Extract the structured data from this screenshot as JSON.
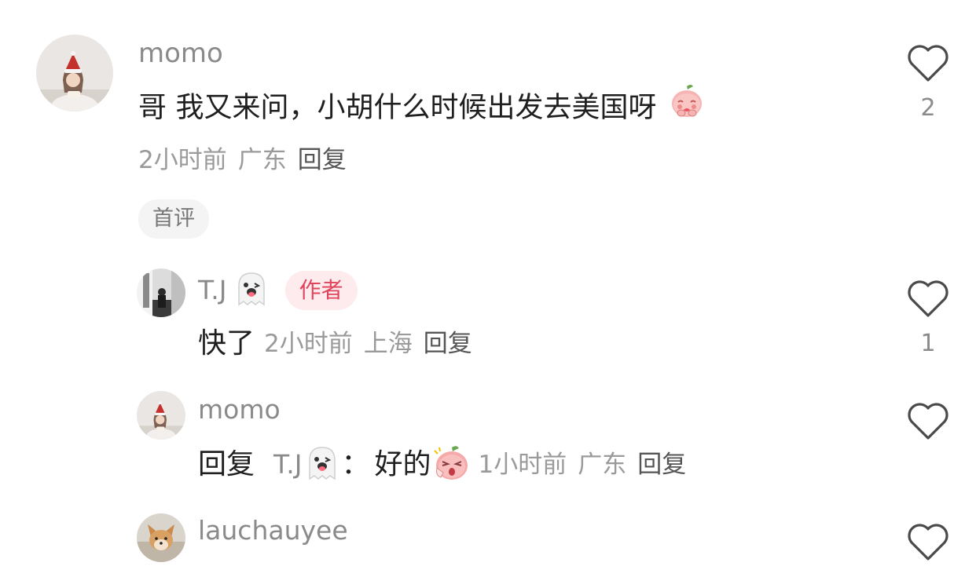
{
  "comments": [
    {
      "username": "momo",
      "text": "哥 我又来问，小胡什么时候出发去美国呀",
      "time": "2小时前",
      "location": "广东",
      "reply_label": "回复",
      "tag": "首评",
      "likes": "2"
    }
  ],
  "replies": [
    {
      "username": "T.J",
      "badge": "作者",
      "text": "快了",
      "time": "2小时前",
      "location": "上海",
      "reply_label": "回复",
      "likes": "1"
    },
    {
      "username": "momo",
      "reply_prefix": "回复",
      "reply_to": "T.J",
      "colon": "：",
      "text": "好的",
      "time": "1小时前",
      "location": "广东",
      "reply_label": "回复",
      "likes": ""
    },
    {
      "username": "lauchauyee"
    }
  ],
  "icons": {
    "like": "heart-outline-icon",
    "ghost": "ghost-emoji-icon",
    "peach_shy": "peach-shy-emoji-icon",
    "peach_shock": "peach-shock-emoji-icon"
  },
  "colors": {
    "author_badge_bg": "#fdebee",
    "author_badge_text": "#e0455d",
    "meta_text": "#9a9a9a"
  }
}
